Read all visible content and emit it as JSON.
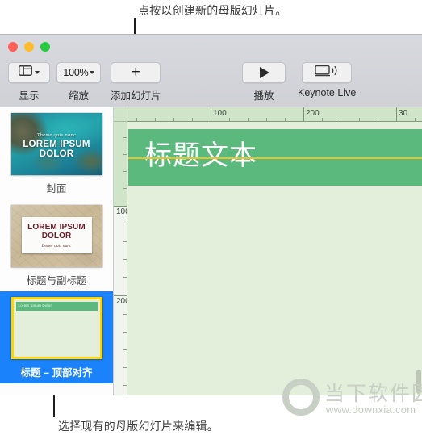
{
  "callouts": {
    "top": "点按以创建新的母版幻灯片。",
    "bottom": "选择现有的母版幻灯片来编辑。"
  },
  "window": {
    "traffic_lights": {
      "close": "close-button",
      "minimize": "minimize-button",
      "zoom": "zoom-button"
    }
  },
  "toolbar": {
    "items": [
      {
        "label": "显示",
        "icon": "view-layout-icon"
      },
      {
        "label": "缩放",
        "value": "100%",
        "icon": "chevron-down-icon"
      },
      {
        "label": "添加幻灯片",
        "icon": "plus-icon"
      },
      {
        "label": "播放",
        "icon": "play-icon"
      },
      {
        "label": "Keynote Live",
        "icon": "display-broadcast-icon"
      }
    ]
  },
  "sidebar": {
    "slides": [
      {
        "caption": "封面",
        "selected": false,
        "thumb": {
          "kind": "ocean-photo",
          "subtitle": "Theme quis nunc",
          "title": "LOREM IPSUM DOLOR"
        }
      },
      {
        "caption": "标题与副标题",
        "selected": false,
        "thumb": {
          "kind": "map-photo",
          "title": "LOREM IPSUM DOLOR",
          "subtitle": "Donec quis nunc"
        }
      },
      {
        "caption": "标题 – 顶部对齐",
        "selected": true,
        "thumb": {
          "kind": "master-layout",
          "title": "Lorem Ipsum Dolor"
        }
      }
    ]
  },
  "canvas": {
    "slide_title": "标题文本",
    "ruler": {
      "horizontal_labels": [
        "100",
        "200",
        "30"
      ],
      "vertical_labels": [
        "100",
        "200"
      ],
      "unit_spacing_px": 114
    },
    "colors": {
      "title_band": "#5cb97e",
      "canvas_background": "#e3eedb",
      "guide_line": "#e8c32a",
      "selection": "#1a82fb",
      "selection_border": "#ffd400"
    }
  },
  "watermark": {
    "name": "当下软件园",
    "url": "www.downxia.com"
  }
}
